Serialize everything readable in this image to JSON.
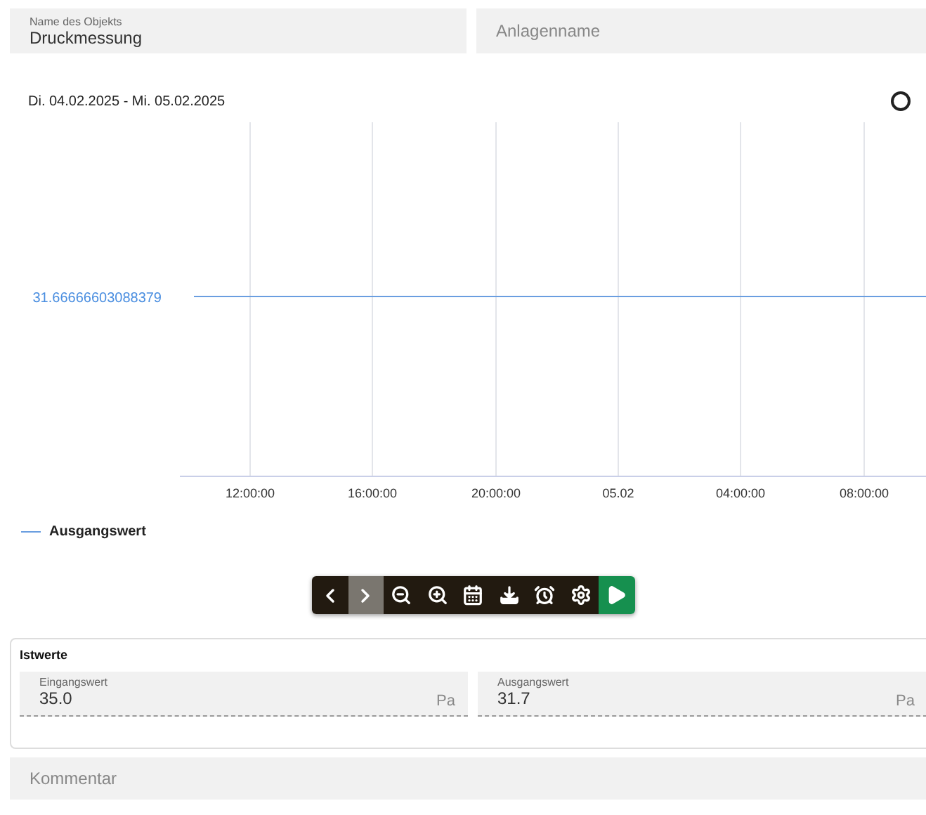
{
  "object_fields": [
    {
      "label": "Name des Objekts",
      "value": "Druckmessung"
    },
    {
      "placeholder": "Anlagenname"
    }
  ],
  "chart": {
    "date_range": "Di. 04.02.2025 - Mi. 05.02.2025",
    "line_label": "31.66666603088379",
    "x_labels": [
      "12:00:00",
      "16:00:00",
      "20:00:00",
      "05.02",
      "04:00:00",
      "08:00:00"
    ],
    "legend": "Ausgangswert"
  },
  "toolbar": [
    {
      "kind": "prev",
      "highlighted": false
    },
    {
      "kind": "next",
      "highlighted": true
    },
    {
      "kind": "zoom-out",
      "highlighted": false
    },
    {
      "kind": "zoom-in",
      "highlighted": false
    },
    {
      "kind": "calendar",
      "highlighted": false
    },
    {
      "kind": "download",
      "highlighted": false
    },
    {
      "kind": "time-shift",
      "highlighted": false
    },
    {
      "kind": "settings",
      "highlighted": false
    },
    {
      "kind": "play",
      "highlighted": false
    }
  ],
  "istwerte": {
    "title": "Istwerte",
    "fields": [
      {
        "label": "Eingangswert",
        "value": "35.0",
        "unit": "Pa"
      },
      {
        "label": "Ausgangswert",
        "value": "31.7",
        "unit": "Pa"
      }
    ]
  },
  "comment": {
    "placeholder": "Kommentar"
  }
}
